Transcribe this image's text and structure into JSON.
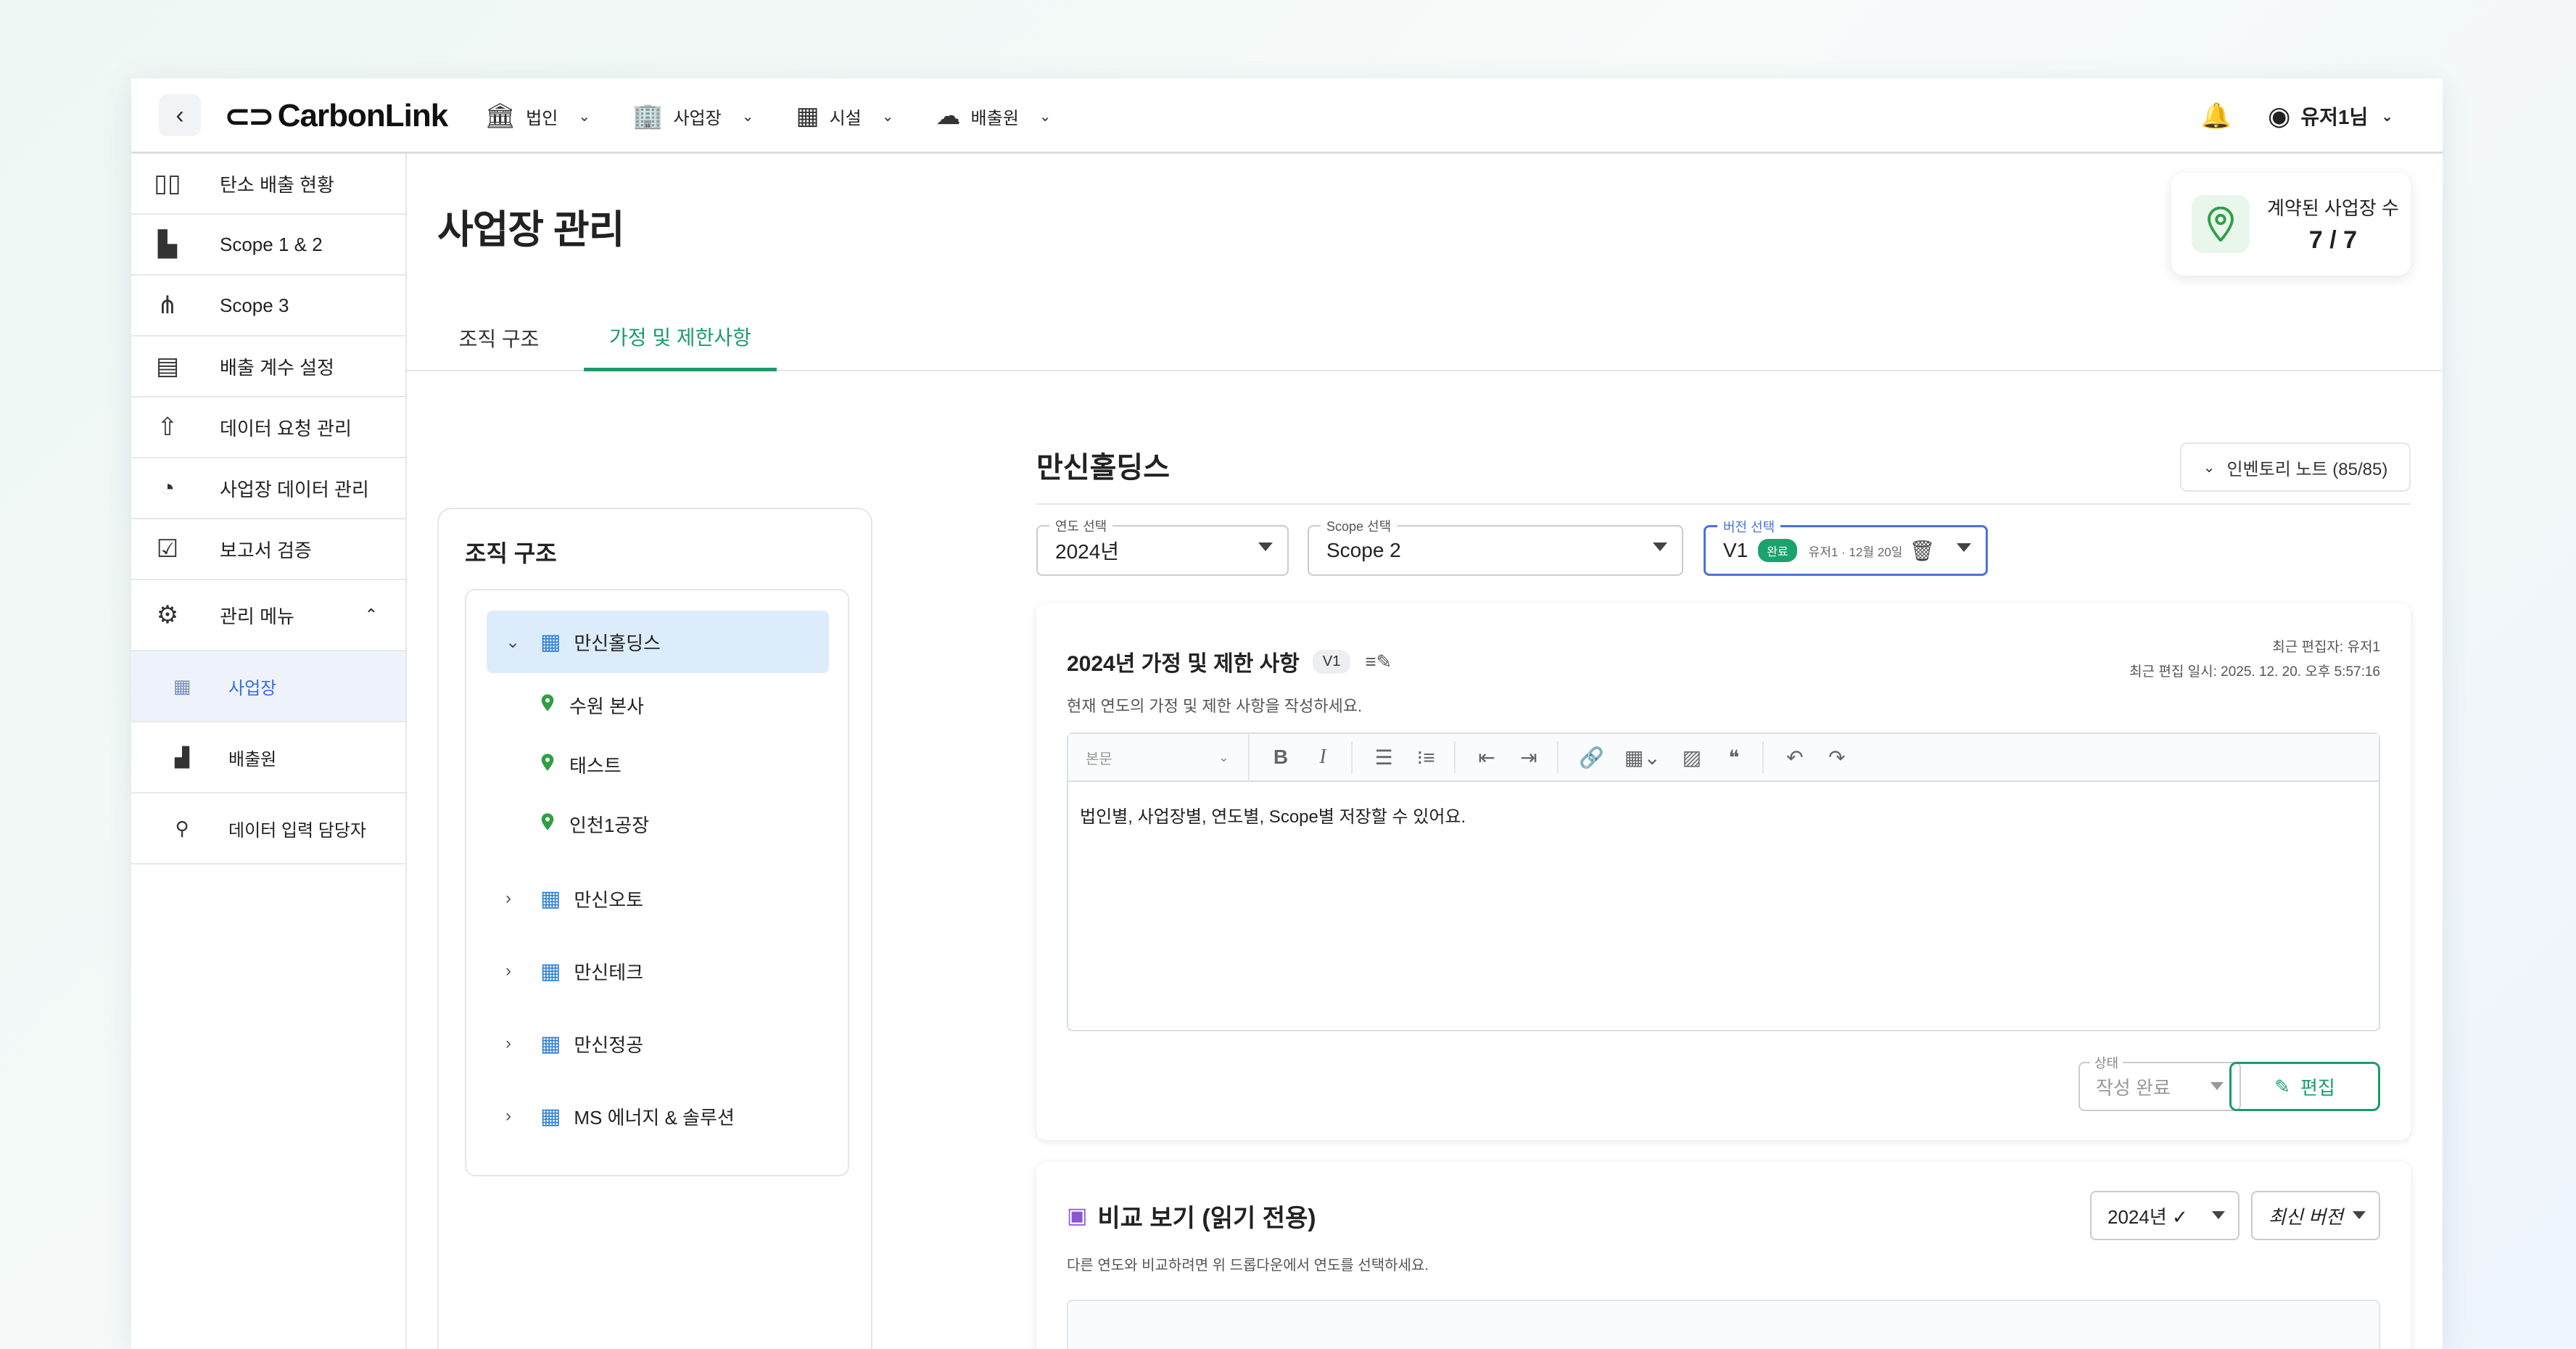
{
  "topbar": {
    "logo_text": "CarbonLink",
    "nav": [
      {
        "label": "법인",
        "icon": "bank-icon"
      },
      {
        "label": "사업장",
        "icon": "buildings-icon"
      },
      {
        "label": "시설",
        "icon": "building-icon"
      },
      {
        "label": "배출원",
        "icon": "co2-cloud-icon"
      }
    ],
    "user_name": "유저1님"
  },
  "sidebar": {
    "items": [
      {
        "label": "탄소 배출 현황",
        "icon": "bar-chart-icon"
      },
      {
        "label": "Scope 1 & 2",
        "icon": "factory-icon"
      },
      {
        "label": "Scope 3",
        "icon": "network-icon"
      },
      {
        "label": "배출 계수 설정",
        "icon": "document-settings-icon"
      },
      {
        "label": "데이터 요청 관리",
        "icon": "cloud-upload-icon"
      },
      {
        "label": "사업장 데이터 관리",
        "icon": "trend-circle-icon"
      },
      {
        "label": "보고서 검증",
        "icon": "report-check-icon"
      },
      {
        "label": "관리 메뉴",
        "icon": "settings-shield-icon"
      }
    ],
    "sub_items": [
      {
        "label": "사업장",
        "icon": "office-icon",
        "active": true
      },
      {
        "label": "배출원",
        "icon": "factory-small-icon",
        "active": false
      },
      {
        "label": "데이터 입력 담당자",
        "icon": "person-icon",
        "active": false
      }
    ]
  },
  "main": {
    "title": "사업장 관리",
    "stat": {
      "label": "계약된 사업장 수",
      "value": "7 / 7"
    },
    "tabs": [
      {
        "label": "조직 구조",
        "active": false
      },
      {
        "label": "가정 및 제한사항",
        "active": true
      }
    ]
  },
  "org": {
    "title": "조직 구조",
    "root": "만신홀딩스",
    "children": [
      "수원 본사",
      "태스트",
      "인천1공장"
    ],
    "companies": [
      "만신오토",
      "만신테크",
      "만신정공",
      "MS 에너지 & 솔루션"
    ]
  },
  "detail": {
    "title": "만신홀딩스",
    "inventory_note": "인벤토리 노트 (85/85)",
    "year_select": {
      "label": "연도 선택",
      "value": "2024년"
    },
    "scope_select": {
      "label": "Scope 선택",
      "value": "Scope 2"
    },
    "version_select": {
      "label": "버전 선택",
      "value": "V1",
      "badge": "완료",
      "meta": "유저1 · 12월 20일"
    },
    "card": {
      "title": "2024년 가정 및 제한 사항",
      "version_badge": "V1",
      "subtitle": "현재 연도의 가정 및 제한 사항을 작성하세요.",
      "last_editor": "최근 편집자: 유저1",
      "last_edit_time": "최근 편집 일시: 2025. 12. 20. 오후 5:57:16",
      "editor_style": "본문",
      "content": "법인별, 사업장별, 연도별, Scope별 저장할 수 있어요.",
      "status_label": "상태",
      "status_value": "작성 완료",
      "edit_button": "편집"
    },
    "compare": {
      "title": "비교 보기 (읽기 전용)",
      "subtitle": "다른 연도와 비교하려면 위 드롭다운에서 연도를 선택하세요.",
      "year_value": "2024년 ✓",
      "version_value": "최신 버전"
    }
  }
}
